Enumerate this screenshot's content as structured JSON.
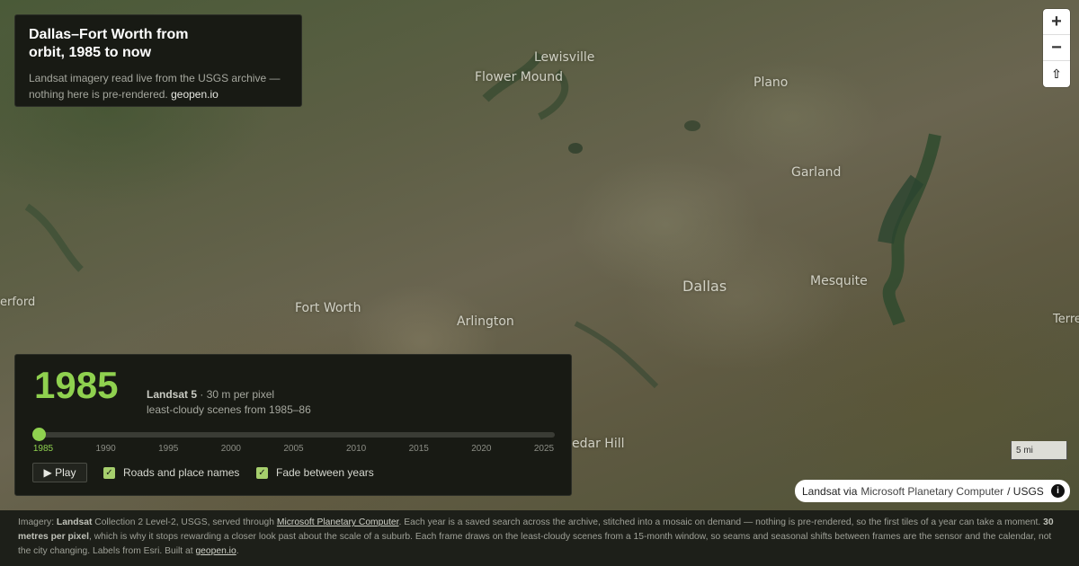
{
  "info": {
    "title": "Dallas–Fort Worth from orbit, 1985 to now",
    "desc": "Landsat imagery read live from the USGS archive — nothing here is pre-rendered.",
    "link": "geopen.io"
  },
  "map": {
    "places": [
      "Lewisville",
      "Flower Mound",
      "Plano",
      "Garland",
      "Dallas",
      "Mesquite",
      "Fort Worth",
      "Arlington",
      "erford",
      "Terre",
      "edar Hill"
    ],
    "scale_label": "5 mi",
    "attribution": {
      "a": "Landsat via",
      "b": "Microsoft Planetary Computer",
      "c": "/ USGS"
    }
  },
  "controls": {
    "zoom_in": "+",
    "zoom_out": "−",
    "compass": "⇧"
  },
  "timeline": {
    "year": "1985",
    "sensor": "Landsat 5",
    "resolution": "· 30 m per pixel",
    "scenes": "least-cloudy scenes from 1985–86",
    "ticks": [
      "1985",
      "1990",
      "1995",
      "2000",
      "2005",
      "2010",
      "2015",
      "2020",
      "2025"
    ],
    "current_index": 0,
    "play_label": "▶ Play",
    "check_roads": "Roads and place names",
    "check_fade": "Fade between years"
  },
  "footer": {
    "p1": "Imagery: ",
    "b1": "Landsat",
    "p2": " Collection 2 Level-2, USGS, served through ",
    "l1": "Microsoft Planetary Computer",
    "p3": ". Each year is a saved search across the archive, stitched into a mosaic on demand — nothing is pre-rendered, so the first tiles of a year can take a moment. ",
    "b2": "30 metres per pixel",
    "p4": ", which is why it stops rewarding a closer look past about the scale of a suburb. Each frame draws on the least-cloudy scenes from a 15-month window, so seams and seasonal shifts between frames are the sensor and the calendar, not the city changing. Labels from Esri. Built at ",
    "l2": "geopen.io",
    "p5": "."
  }
}
